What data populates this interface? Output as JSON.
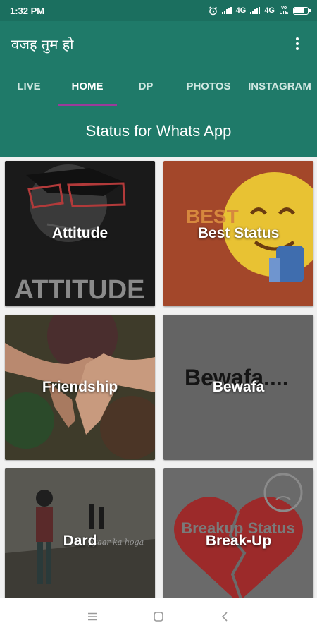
{
  "status_bar": {
    "time": "1:32 PM",
    "network_1": "4G",
    "network_2": "4G",
    "volte": "Vo LTE"
  },
  "app_bar": {
    "title": "वजह तुम हो",
    "menu_icon": "overflow-menu-icon"
  },
  "tabs": [
    {
      "label": "LIVE",
      "active": false
    },
    {
      "label": "HOME",
      "active": true
    },
    {
      "label": "DP",
      "active": false
    },
    {
      "label": "PHOTOS",
      "active": false
    },
    {
      "label": "INSTAGRAM",
      "active": false
    }
  ],
  "section": {
    "title": "Status for Whats App"
  },
  "categories": [
    {
      "label": "Attitude",
      "image_text": "ATTITUDE"
    },
    {
      "label": "Best Status",
      "image_text": "BEST"
    },
    {
      "label": "Friendship"
    },
    {
      "label": "Bewafa",
      "image_text": "Bewafa...."
    },
    {
      "label": "Dard",
      "image_text": "pyaar ka hoga"
    },
    {
      "label": "Break-Up",
      "image_text": "Breakup Status"
    }
  ],
  "colors": {
    "primary": "#1f7a69",
    "status_bar": "#1b6f5f",
    "tab_indicator": "#9b3a9a"
  },
  "nav_bar": {
    "icons": [
      "menu-icon",
      "home-square-icon",
      "back-icon"
    ]
  }
}
